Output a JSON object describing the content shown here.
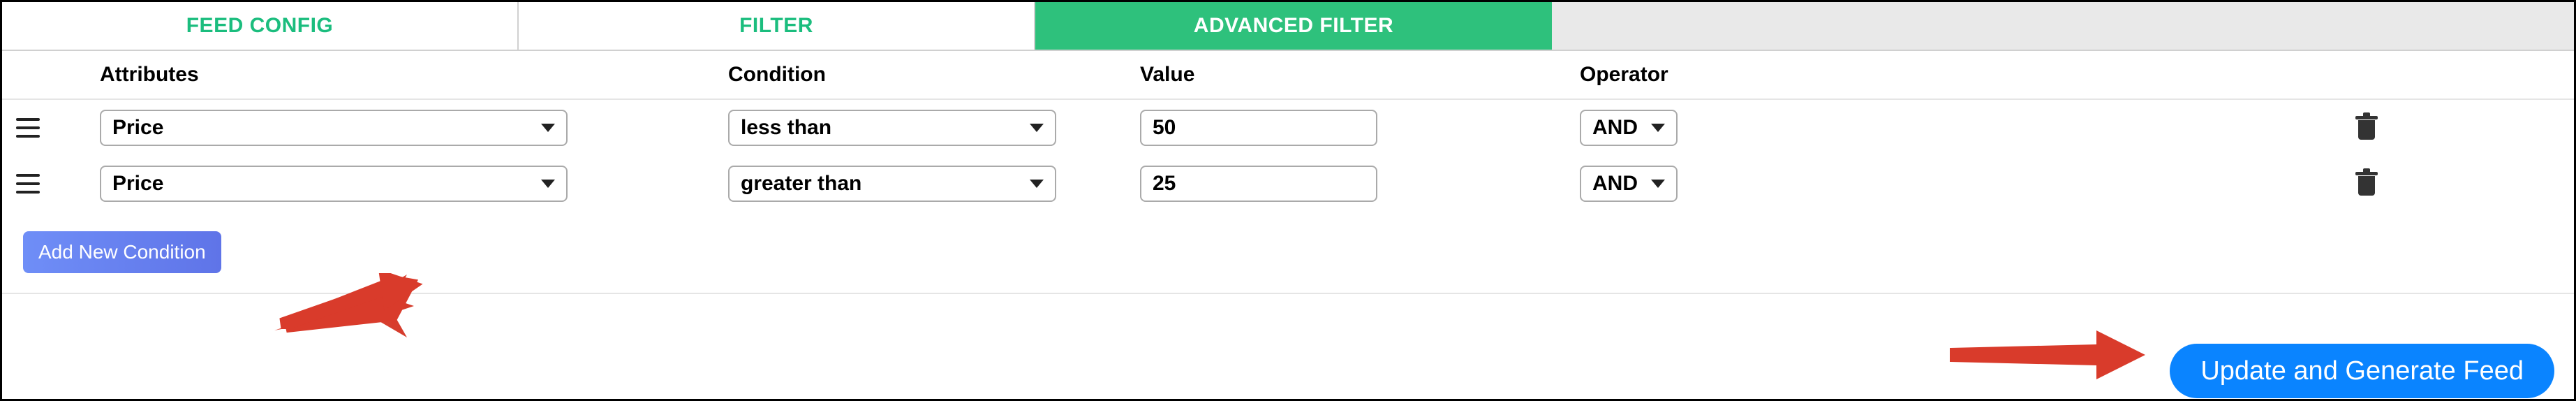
{
  "tabs": {
    "feed_config": "FEED CONFIG",
    "filter": "FILTER",
    "advanced_filter": "ADVANCED FILTER"
  },
  "headers": {
    "attributes": "Attributes",
    "condition": "Condition",
    "value": "Value",
    "operator": "Operator"
  },
  "rows": [
    {
      "attribute": "Price",
      "condition": "less than",
      "value": "50",
      "operator": "AND"
    },
    {
      "attribute": "Price",
      "condition": "greater than",
      "value": "25",
      "operator": "AND"
    }
  ],
  "buttons": {
    "add_condition": "Add New Condition",
    "update_feed": "Update and Generate Feed"
  }
}
